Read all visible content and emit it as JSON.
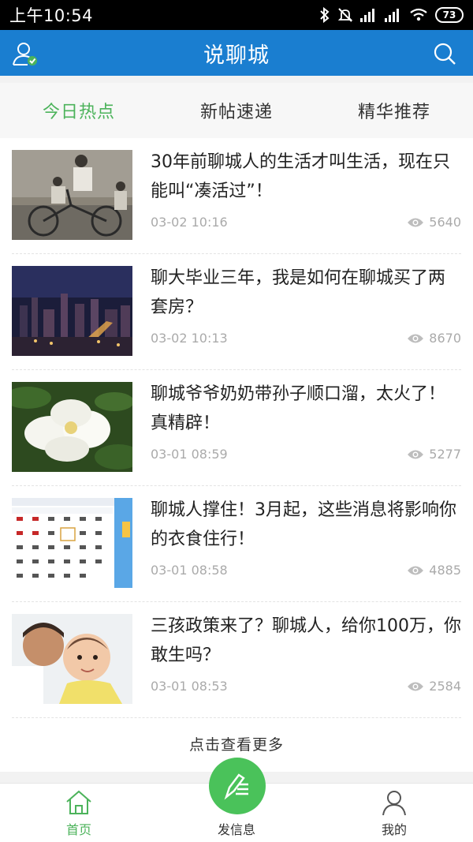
{
  "status_bar": {
    "time": "上午10:54",
    "battery": "73"
  },
  "header": {
    "title": "说聊城"
  },
  "tabs": [
    {
      "label": "今日热点",
      "active": true
    },
    {
      "label": "新帖速递",
      "active": false
    },
    {
      "label": "精华推荐",
      "active": false
    }
  ],
  "articles": [
    {
      "title": "30年前聊城人的生活才叫生活，现在只能叫“凑活过”！",
      "date": "03-02 10:16",
      "views": "5640",
      "image": "vintage-bicycle-family-photo"
    },
    {
      "title": "聊大毕业三年，我是如何在聊城买了两套房？",
      "date": "03-02 10:13",
      "views": "8670",
      "image": "city-night-skyline-photo"
    },
    {
      "title": "聊城爷爷奶奶带孙子顺口溜，太火了！真精辟！",
      "date": "03-01 08:59",
      "views": "5277",
      "image": "white-gardenia-flower-photo"
    },
    {
      "title": "聊城人撑住！3月起，这些消息将影响你的衣食住行！",
      "date": "03-01 08:58",
      "views": "4885",
      "image": "calendar-screenshot"
    },
    {
      "title": "三孩政策来了？聊城人，给你100万，你敢生吗？",
      "date": "03-01 08:53",
      "views": "2584",
      "image": "boy-kissing-baby-photo"
    }
  ],
  "load_more": "点击查看更多",
  "bottom_nav": {
    "home": "首页",
    "post": "发信息",
    "mine": "我的"
  },
  "colors": {
    "header_blue": "#1a7ed0",
    "accent_green": "#4cb35b"
  }
}
